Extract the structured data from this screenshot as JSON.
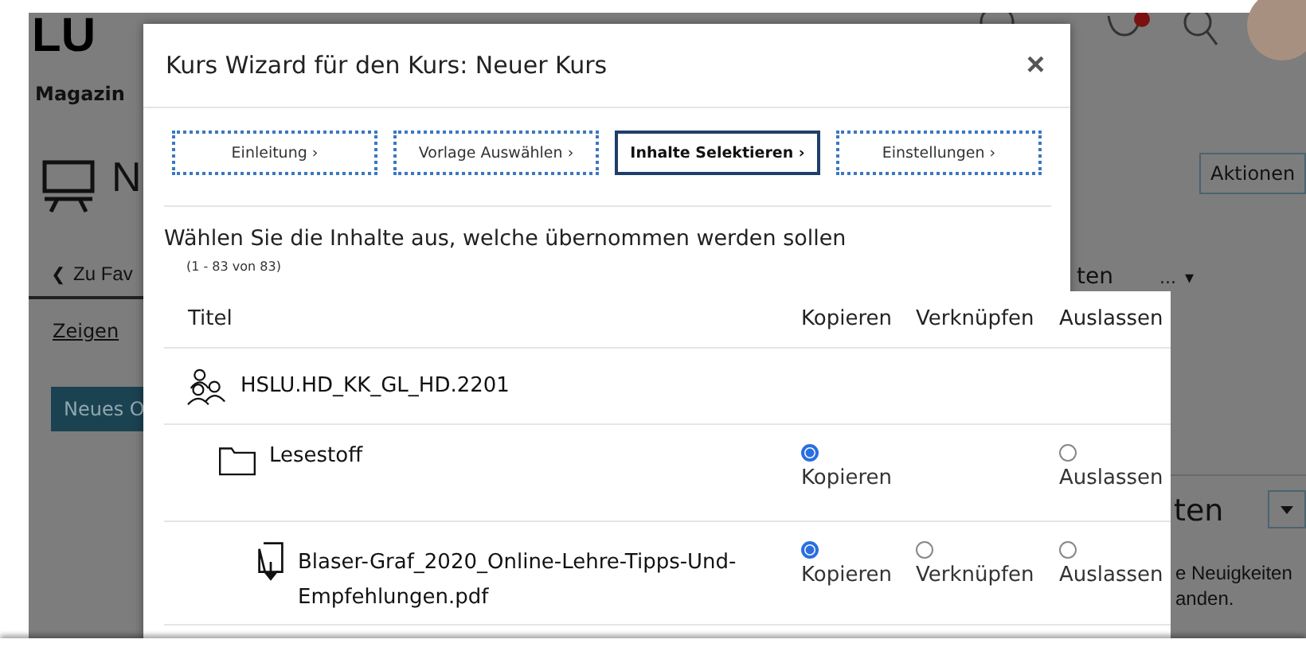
{
  "background": {
    "logo": "LU",
    "nav_item": "Magazin",
    "page_title": "N",
    "back_icon": "❮",
    "back_link": "Zu Fav",
    "show_link": "Zeigen",
    "new_button": "Neues O",
    "actions_button": "Aktionen",
    "tab_fragment": "ten",
    "more_menu": "...",
    "more_caret": "▾",
    "panel_title_fragment": "ten",
    "news_lines": [
      "e Neuigkeiten",
      "anden."
    ]
  },
  "dialog": {
    "title": "Kurs Wizard für den Kurs: Neuer Kurs",
    "close": "×",
    "steps": [
      {
        "label": "Einleitung ›",
        "selected": false
      },
      {
        "label": "Vorlage Auswählen ›",
        "selected": false
      },
      {
        "label": "Inhalte Selektieren ›",
        "selected": true
      },
      {
        "label": "Einstellungen ›",
        "selected": false
      }
    ],
    "instruction": "Wählen Sie die Inhalte aus, welche übernommen werden sollen",
    "count": "(1 - 83 von 83)",
    "columns": [
      "Titel",
      "Kopieren",
      "Verknüpfen",
      "Auslassen"
    ],
    "rows": [
      {
        "kind": "course",
        "title": "HSLU.HD_KK_GL_HD.2201",
        "options": []
      },
      {
        "kind": "folder",
        "title": "Lesestoff",
        "options": [
          {
            "kind": "copy",
            "label": "Kopieren",
            "selected": true
          },
          {
            "kind": "omit",
            "label": "Auslassen",
            "selected": false
          }
        ]
      },
      {
        "kind": "file",
        "title": "Blaser-Graf_2020_Online-Lehre-Tipps-Und-Empfehlungen.pdf",
        "options": [
          {
            "kind": "copy",
            "label": "Kopieren",
            "selected": true
          },
          {
            "kind": "link",
            "label": "Verknüpfen",
            "selected": false
          },
          {
            "kind": "omit",
            "label": "Auslassen",
            "selected": false
          }
        ]
      }
    ]
  }
}
